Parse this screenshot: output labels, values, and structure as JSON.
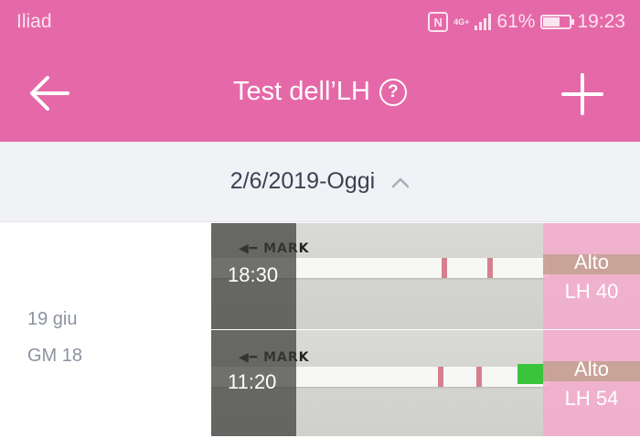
{
  "status_bar": {
    "carrier": "Iliad",
    "network": "4G+",
    "battery": "61%",
    "battery_level": 0.61,
    "time": "19:23"
  },
  "app_bar": {
    "title": "Test dell’LH",
    "help_icon_label": "?",
    "back_icon": "arrow-left-icon",
    "add_icon": "plus-icon"
  },
  "date_range": {
    "label": "2/6/2019-Oggi",
    "toggle_icon": "chevron-up-icon"
  },
  "day": {
    "date": "19 giu",
    "cycle_day": "GM 18"
  },
  "tests": [
    {
      "time": "18:30",
      "mark_text": "MARK",
      "result": "Alto",
      "lh_value": "LH 40"
    },
    {
      "time": "11:20",
      "mark_text": "MARK",
      "result": "Alto",
      "lh_value": "LH 54"
    }
  ],
  "colors": {
    "accent": "#e569a8",
    "range_bg": "#f1f2f6",
    "result_bg": "#f5aacd"
  }
}
